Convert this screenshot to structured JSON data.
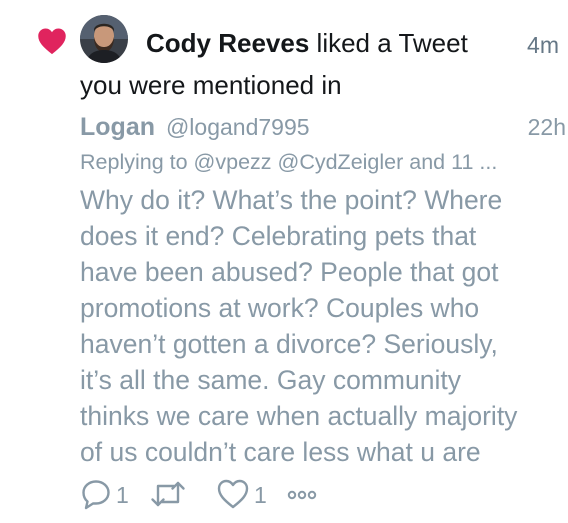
{
  "notification": {
    "type_icon": "heart-icon",
    "actor_avatar": "avatar",
    "actor_name": "Cody Reeves",
    "action_text": "liked a Tweet",
    "action_text_2": "you were mentioned in",
    "time": "4m"
  },
  "tweet": {
    "author_name": "Logan",
    "author_handle": "@logand7995",
    "time": "22h",
    "replying_to": "Replying to @vpezz @CydZeigler and 11 ...",
    "body_lines": [
      "Why do it? What’s the point? Where",
      "does it end? Celebrating pets that",
      "have been abused? People that got",
      "promotions at work? Couples who",
      "haven’t gotten a divorce? Seriously,",
      "it’s all the same. Gay community",
      "thinks we care when actually majority",
      "of us couldn’t care less what u are"
    ],
    "reply_count": "1",
    "like_count": "1",
    "retweet_icon": "retweet-icon",
    "more_icon": "more-icon"
  },
  "colors": {
    "like_red": "#e0245e",
    "muted_gray": "#8899a6",
    "text": "#14171a"
  }
}
